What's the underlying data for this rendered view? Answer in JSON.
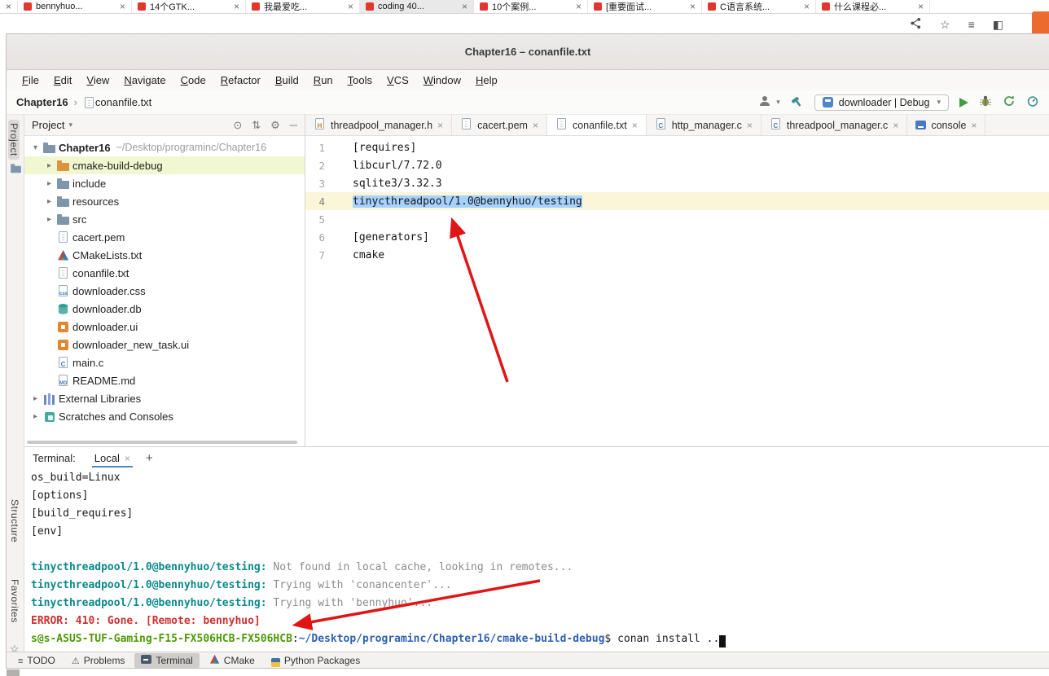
{
  "browser": {
    "tabs": [
      {
        "label": "bennyhuo..."
      },
      {
        "label": "14个GTK..."
      },
      {
        "label": "我最爱吃..."
      },
      {
        "label": "coding 40...",
        "active": true
      },
      {
        "label": "10个案例..."
      },
      {
        "label": "[重要面试..."
      },
      {
        "label": "C语言系统..."
      },
      {
        "label": "什么课程必..."
      }
    ]
  },
  "window": {
    "title": "Chapter16 – conanfile.txt"
  },
  "menu": {
    "items": [
      "File",
      "Edit",
      "View",
      "Navigate",
      "Code",
      "Refactor",
      "Build",
      "Run",
      "Tools",
      "VCS",
      "Window",
      "Help"
    ]
  },
  "navbar": {
    "project": "Chapter16",
    "file": "conanfile.txt",
    "run_config": "downloader | Debug"
  },
  "stripes": {
    "project": "Project",
    "structure": "Structure",
    "favorites": "Favorites"
  },
  "project": {
    "title": "Project",
    "tree": [
      {
        "depth": 0,
        "chevron": "down",
        "icon": "project-folder",
        "label": "Chapter16",
        "path": "~/Desktop/programinc/Chapter16",
        "bold": true
      },
      {
        "depth": 1,
        "chevron": "right",
        "icon": "excluded-folder",
        "label": "cmake-build-debug",
        "highlight": true
      },
      {
        "depth": 1,
        "chevron": "right",
        "icon": "folder",
        "label": "include"
      },
      {
        "depth": 1,
        "chevron": "right",
        "icon": "folder",
        "label": "resources"
      },
      {
        "depth": 1,
        "chevron": "right",
        "icon": "folder",
        "label": "src"
      },
      {
        "depth": 1,
        "icon": "text-file",
        "label": "cacert.pem"
      },
      {
        "depth": 1,
        "icon": "cmake-file",
        "label": "CMakeLists.txt"
      },
      {
        "depth": 1,
        "icon": "text-file",
        "label": "conanfile.txt"
      },
      {
        "depth": 1,
        "icon": "css-file",
        "label": "downloader.css"
      },
      {
        "depth": 1,
        "icon": "db-file",
        "label": "downloader.db"
      },
      {
        "depth": 1,
        "icon": "ui-file",
        "label": "downloader.ui"
      },
      {
        "depth": 1,
        "icon": "ui-file",
        "label": "downloader_new_task.ui"
      },
      {
        "depth": 1,
        "icon": "c-file",
        "label": "main.c"
      },
      {
        "depth": 1,
        "icon": "md-file",
        "label": "README.md"
      },
      {
        "depth": 0,
        "chevron": "right",
        "icon": "libs",
        "label": "External Libraries"
      },
      {
        "depth": 0,
        "chevron": "right",
        "icon": "scratch",
        "label": "Scratches and Consoles"
      }
    ]
  },
  "editor": {
    "tabs": [
      {
        "label": "threadpool_manager.h",
        "icon": "h-file"
      },
      {
        "label": "cacert.pem",
        "icon": "text-file"
      },
      {
        "label": "conanfile.txt",
        "icon": "text-file",
        "active": true
      },
      {
        "label": "http_manager.c",
        "icon": "c-file"
      },
      {
        "label": "threadpool_manager.c",
        "icon": "c-file"
      },
      {
        "label": "console",
        "icon": "console"
      }
    ],
    "lines": [
      {
        "n": "1",
        "text": "[requires]"
      },
      {
        "n": "2",
        "text": "libcurl/7.72.0"
      },
      {
        "n": "3",
        "text": "sqlite3/3.32.3"
      },
      {
        "n": "4",
        "text": "tinycthreadpool/1.0@bennyhuo/testing",
        "selected": true
      },
      {
        "n": "5",
        "text": ""
      },
      {
        "n": "6",
        "text": "[generators]"
      },
      {
        "n": "7",
        "text": "cmake"
      }
    ]
  },
  "terminal": {
    "title": "Terminal:",
    "tab_label": "Local",
    "lines": [
      [
        {
          "c": "d",
          "t": "os_build=Linux"
        }
      ],
      [
        {
          "c": "d",
          "t": "[options]"
        }
      ],
      [
        {
          "c": "d",
          "t": "[build_requires]"
        }
      ],
      [
        {
          "c": "d",
          "t": "[env]"
        }
      ],
      [],
      [
        {
          "c": "c",
          "t": "tinycthreadpool/1.0@bennyhuo/testing:"
        },
        {
          "c": "g",
          "t": " Not found in local cache, looking in remotes..."
        }
      ],
      [
        {
          "c": "c",
          "t": "tinycthreadpool/1.0@bennyhuo/testing:"
        },
        {
          "c": "g",
          "t": " Trying with 'conancenter'..."
        }
      ],
      [
        {
          "c": "c",
          "t": "tinycthreadpool/1.0@bennyhuo/testing:"
        },
        {
          "c": "g",
          "t": " Trying with 'bennyhuo'..."
        }
      ],
      [
        {
          "c": "r",
          "t": "ERROR: 410: Gone. [Remote: bennyhuo]"
        }
      ],
      [
        {
          "c": "gr",
          "t": "s@s-ASUS-TUF-Gaming-F15-FX506HCB-FX506HCB"
        },
        {
          "c": "d",
          "t": ":"
        },
        {
          "c": "b",
          "t": "~/Desktop/programinc/Chapter16/cmake-build-debug"
        },
        {
          "c": "d",
          "t": "$ conan install .."
        },
        {
          "c": "cur",
          "t": " "
        }
      ]
    ]
  },
  "status_bar": {
    "items": [
      {
        "label": "TODO",
        "icon": "todo"
      },
      {
        "label": "Problems",
        "icon": "problems"
      },
      {
        "label": "Terminal",
        "icon": "terminal",
        "active": true
      },
      {
        "label": "CMake",
        "icon": "cmake"
      },
      {
        "label": "Python Packages",
        "icon": "python"
      }
    ]
  },
  "icons": {
    "close": "×",
    "plus": "+",
    "star": "☆",
    "gear": "⚙",
    "minus": "─",
    "target": "⊙",
    "updown": "⇅",
    "chevron_down": "▾",
    "chevron_right": "▸",
    "breadcrumb_sep": "›",
    "sidebar": "◧",
    "library": "≡",
    "todo": "≡",
    "warning": "⚠"
  },
  "colors": {
    "selection_blue": "#a6d2ff",
    "caret_row_yellow": "#fbf5da",
    "tree_highlight": "#f1f7d0",
    "ansi_cyan": "#0a8a8a",
    "error_red": "#d02f2f",
    "prompt_green": "#4e9a06",
    "path_blue": "#2f62b5",
    "arrow_red": "#e01616",
    "favicon_red": "#e0382e",
    "corner_orange": "#ed6a2f"
  }
}
